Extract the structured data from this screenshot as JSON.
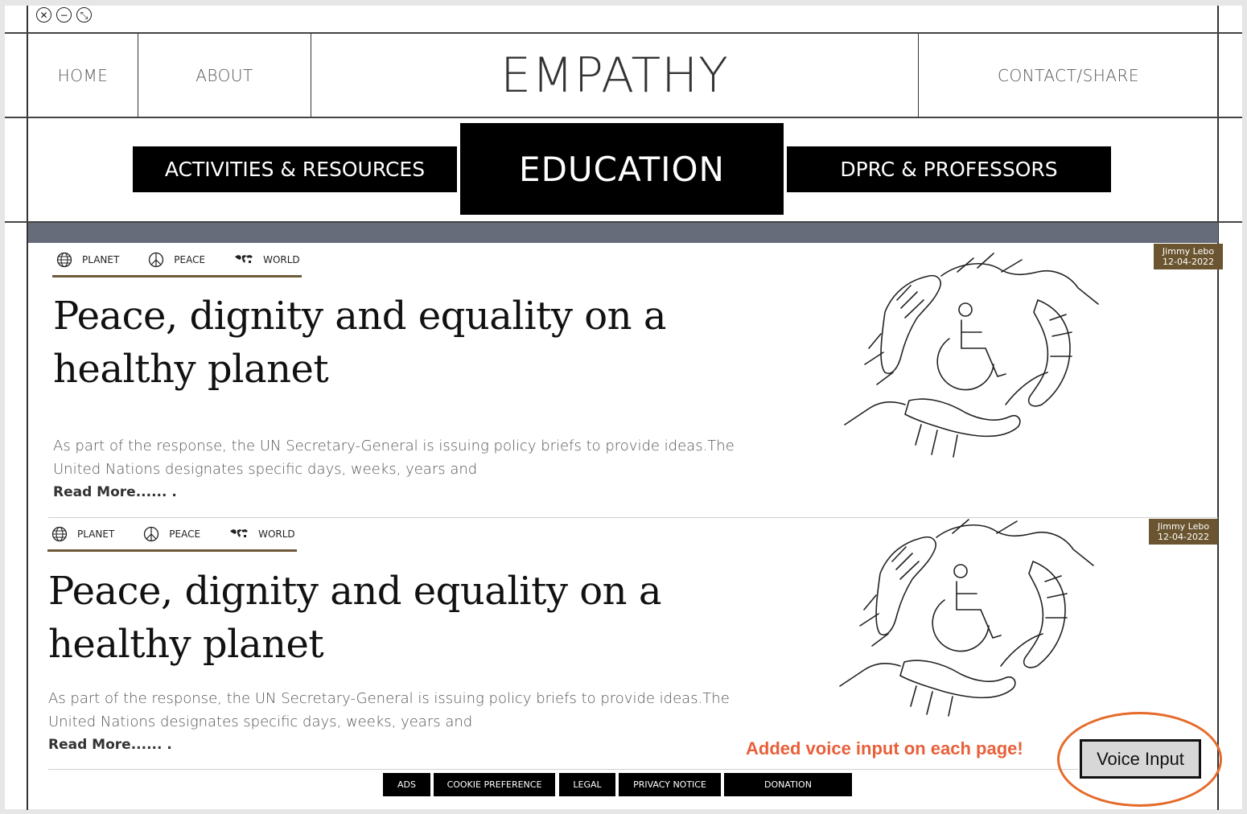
{
  "window": {
    "controls": [
      {
        "name": "close",
        "glyph": "✕"
      },
      {
        "name": "minimize",
        "glyph": "−"
      },
      {
        "name": "restore",
        "glyph": "⤡"
      }
    ]
  },
  "nav": {
    "home": "HOME",
    "about": "ABOUT",
    "site_title": "EMPATHY",
    "contact": "CONTACT/SHARE"
  },
  "tabs": {
    "activities": "ACTIVITIES & RESOURCES",
    "education": "EDUCATION",
    "dprc": "DPRC & PROFESSORS"
  },
  "articles": [
    {
      "tags": [
        {
          "label": "PLANET",
          "icon": "globe-icon"
        },
        {
          "label": "PEACE",
          "icon": "peace-icon"
        },
        {
          "label": "WORLD",
          "icon": "world-map-icon"
        }
      ],
      "title_line1": "Peace, dignity and equality on a",
      "title_line2": "healthy planet",
      "body_line1": "As part of the response, the UN Secretary-General is issuing policy briefs to provide ideas.The",
      "body_line2": "United Nations designates specific days, weeks, years and",
      "read_more": "Read More...... .",
      "author": "Jimmy Lebo",
      "date": "12-04-2022"
    },
    {
      "tags": [
        {
          "label": "PLANET",
          "icon": "globe-icon"
        },
        {
          "label": "PEACE",
          "icon": "peace-icon"
        },
        {
          "label": "WORLD",
          "icon": "world-map-icon"
        }
      ],
      "title_line1": "Peace, dignity and equality on a",
      "title_line2": "healthy planet",
      "body_line1": "As part of the response, the UN Secretary-General is issuing policy briefs to provide ideas.The",
      "body_line2": "United Nations designates specific days, weeks, years and",
      "read_more": "Read More...... .",
      "author": "Jimmy Lebo",
      "date": "12-04-2022"
    }
  ],
  "footer": {
    "ads": "ADS",
    "cookie": "COOKIE PREFERENCE",
    "legal": "LEGAL",
    "privacy": "PRIVACY NOTICE",
    "donation": "DONATION"
  },
  "voice": {
    "note": "Added voice input on each page!",
    "button": "Voice Input"
  },
  "colors": {
    "banner": "#676c7b",
    "accent_brown": "#6b5530",
    "annotation_orange": "#e8603a"
  }
}
